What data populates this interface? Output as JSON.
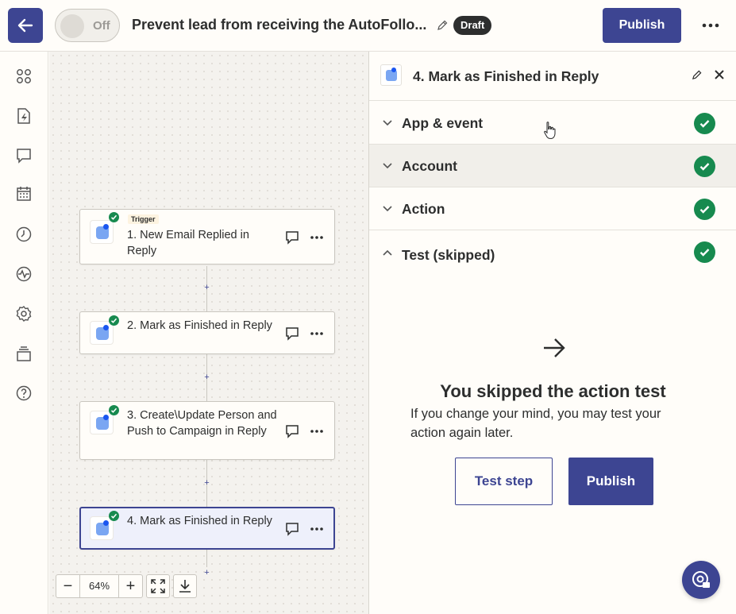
{
  "topbar": {
    "toggle_label": "Off",
    "zap_title": "Prevent lead from receiving the AutoFollo...",
    "draft_badge": "Draft",
    "publish_label": "Publish"
  },
  "canvas": {
    "steps": [
      {
        "tag": "Trigger",
        "title": "1. New Email Replied in Reply"
      },
      {
        "title": "2. Mark as Finished in Reply"
      },
      {
        "title": "3. Create\\Update Person and Push to Campaign in Reply"
      },
      {
        "title": "4. Mark as Finished in Reply"
      }
    ],
    "plus_label": "+",
    "zoom": {
      "minus": "−",
      "value": "64%",
      "plus": "+"
    }
  },
  "panel": {
    "title": "4. Mark as Finished in Reply",
    "sections": [
      {
        "label": "App & event"
      },
      {
        "label": "Account"
      },
      {
        "label": "Action"
      },
      {
        "label": "Test (skipped)"
      }
    ],
    "skip_heading": "You skipped the action test",
    "skip_text": "If you change your mind, you may test your action again later.",
    "test_step_label": "Test step",
    "publish_label": "Publish"
  },
  "colors": {
    "primary": "#3d4592",
    "success": "#178a4f",
    "background": "#fffdf9",
    "canvas": "#f4f2ee"
  }
}
